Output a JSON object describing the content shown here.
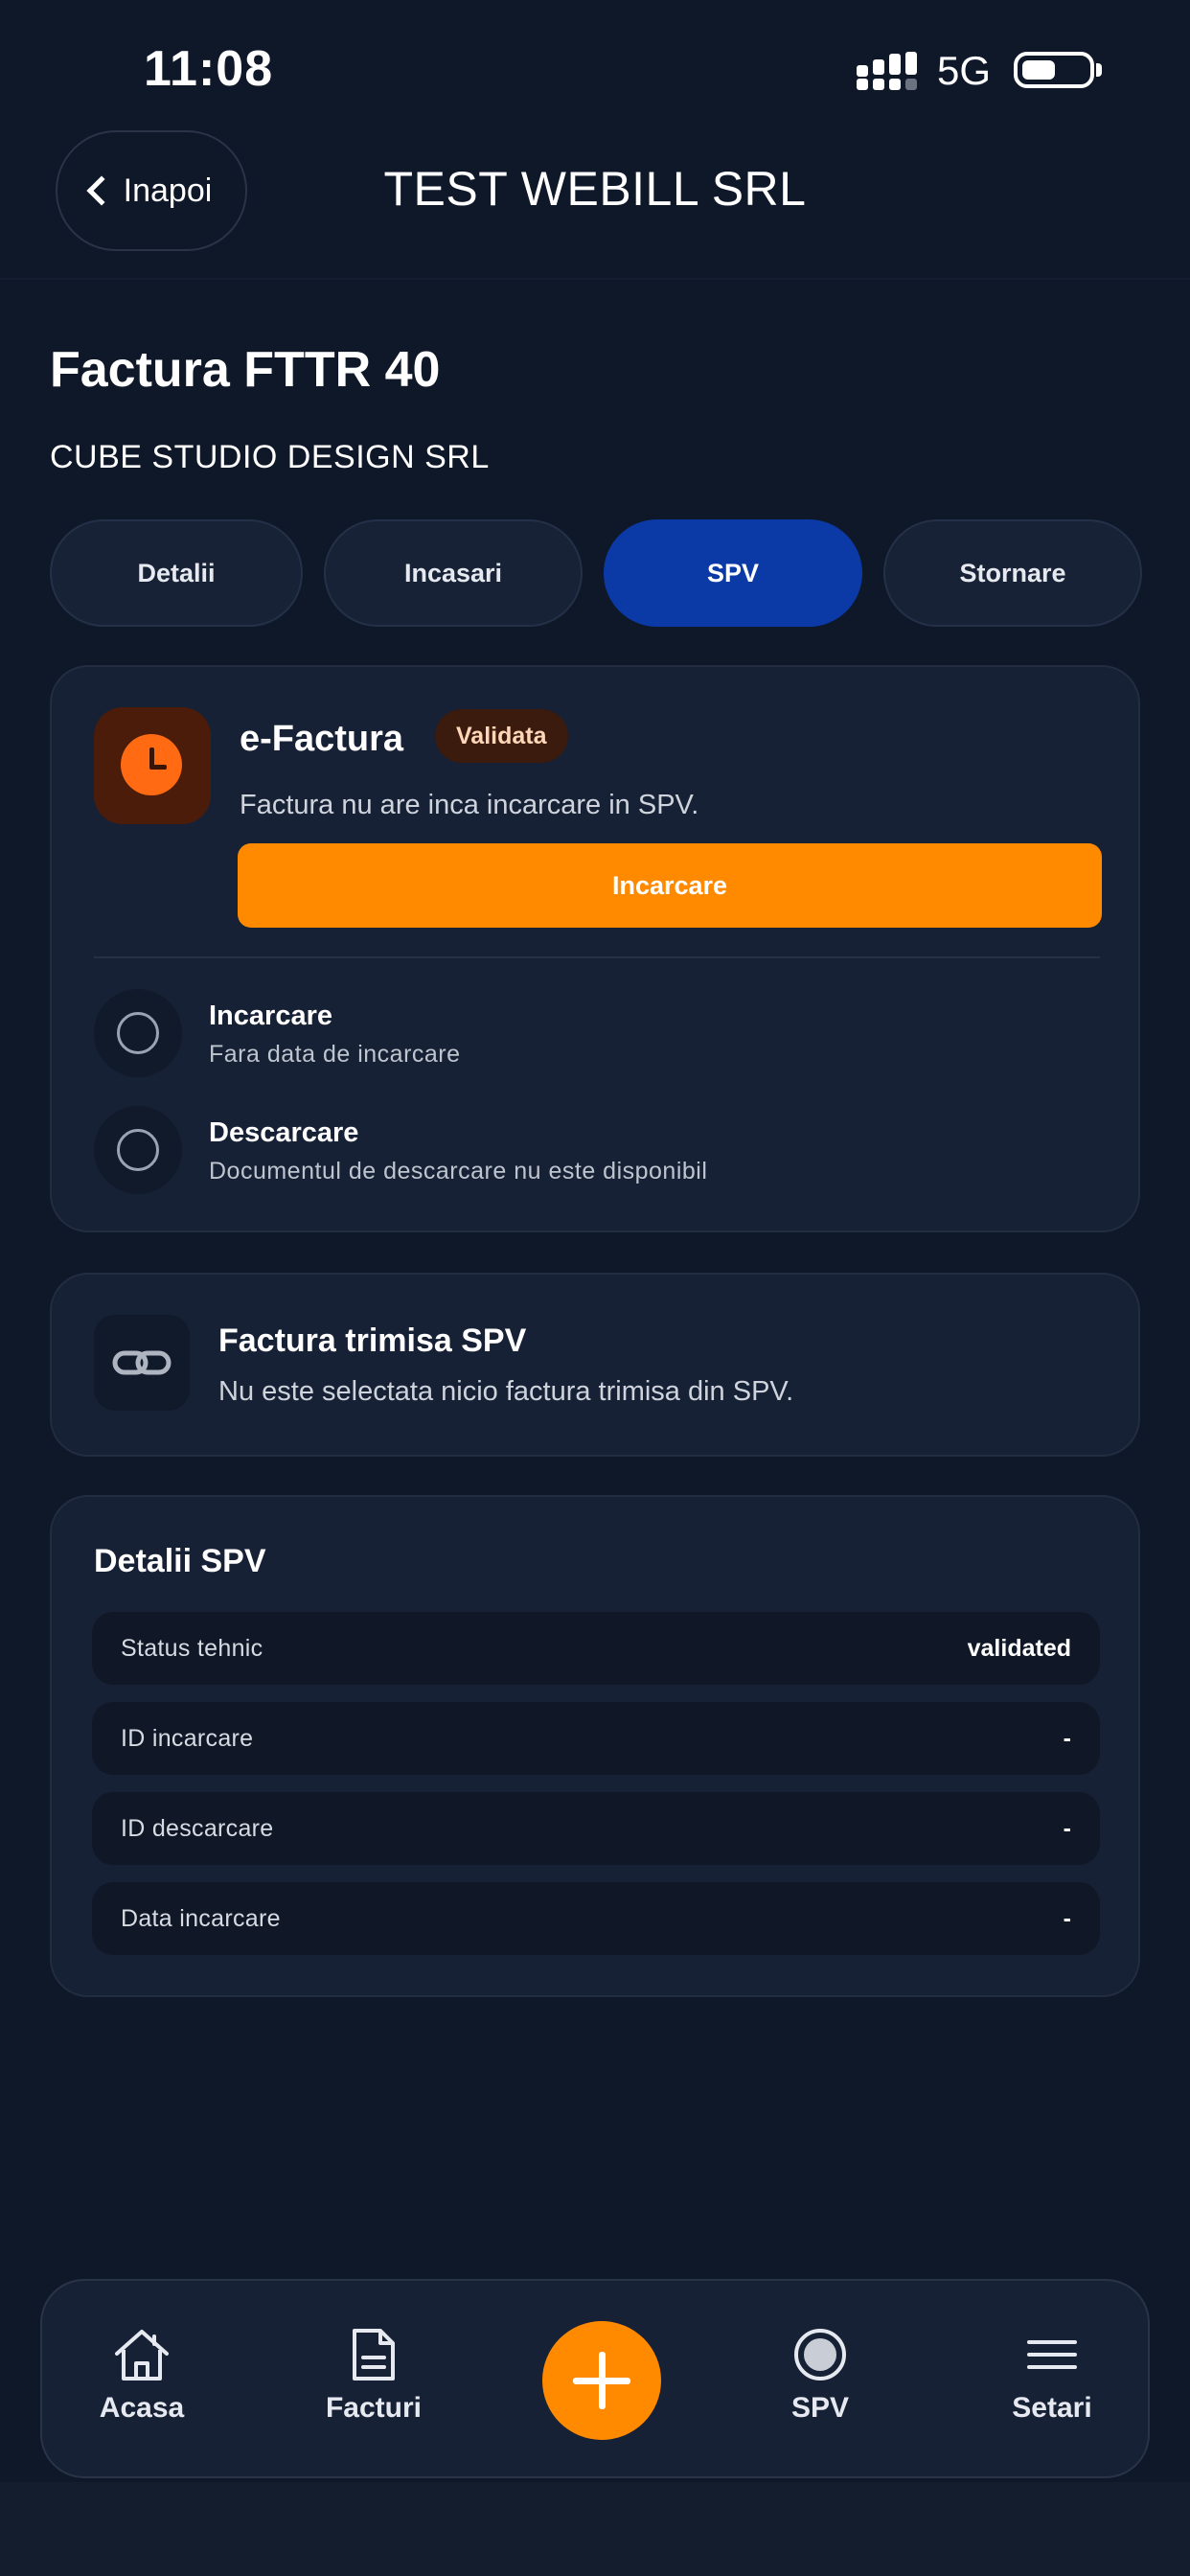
{
  "status_bar": {
    "time": "11:08",
    "network": "5G"
  },
  "header": {
    "back_label": "Inapoi",
    "title": "TEST WEBILL SRL"
  },
  "invoice": {
    "title": "Factura FTTR 40",
    "client": "CUBE STUDIO DESIGN SRL"
  },
  "tabs": [
    {
      "label": "Detalii",
      "active": false
    },
    {
      "label": "Incasari",
      "active": false
    },
    {
      "label": "SPV",
      "active": true
    },
    {
      "label": "Stornare",
      "active": false
    }
  ],
  "efactura": {
    "title": "e-Factura",
    "badge": "Validata",
    "message": "Factura nu are inca incarcare in SPV.",
    "upload_button": "Incarcare",
    "steps": [
      {
        "title": "Incarcare",
        "subtitle": "Fara data de incarcare"
      },
      {
        "title": "Descarcare",
        "subtitle": "Documentul de descarcare nu este disponibil"
      }
    ]
  },
  "sent_invoice": {
    "title": "Factura trimisa SPV",
    "message": "Nu este selectata nicio factura trimisa din SPV."
  },
  "spv_details": {
    "title": "Detalii SPV",
    "rows": [
      {
        "label": "Status tehnic",
        "value": "validated"
      },
      {
        "label": "ID incarcare",
        "value": "-"
      },
      {
        "label": "ID descarcare",
        "value": "-"
      },
      {
        "label": "Data incarcare",
        "value": "-"
      }
    ]
  },
  "bottom_nav": {
    "items": [
      {
        "label": "Acasa",
        "icon": "home-icon"
      },
      {
        "label": "Facturi",
        "icon": "document-icon"
      },
      {
        "label": "SPV",
        "icon": "spv-icon"
      },
      {
        "label": "Setari",
        "icon": "menu-icon"
      }
    ]
  },
  "colors": {
    "background": "#0f1829",
    "accent": "#ff8a00",
    "active_tab": "#0b3aa6"
  }
}
